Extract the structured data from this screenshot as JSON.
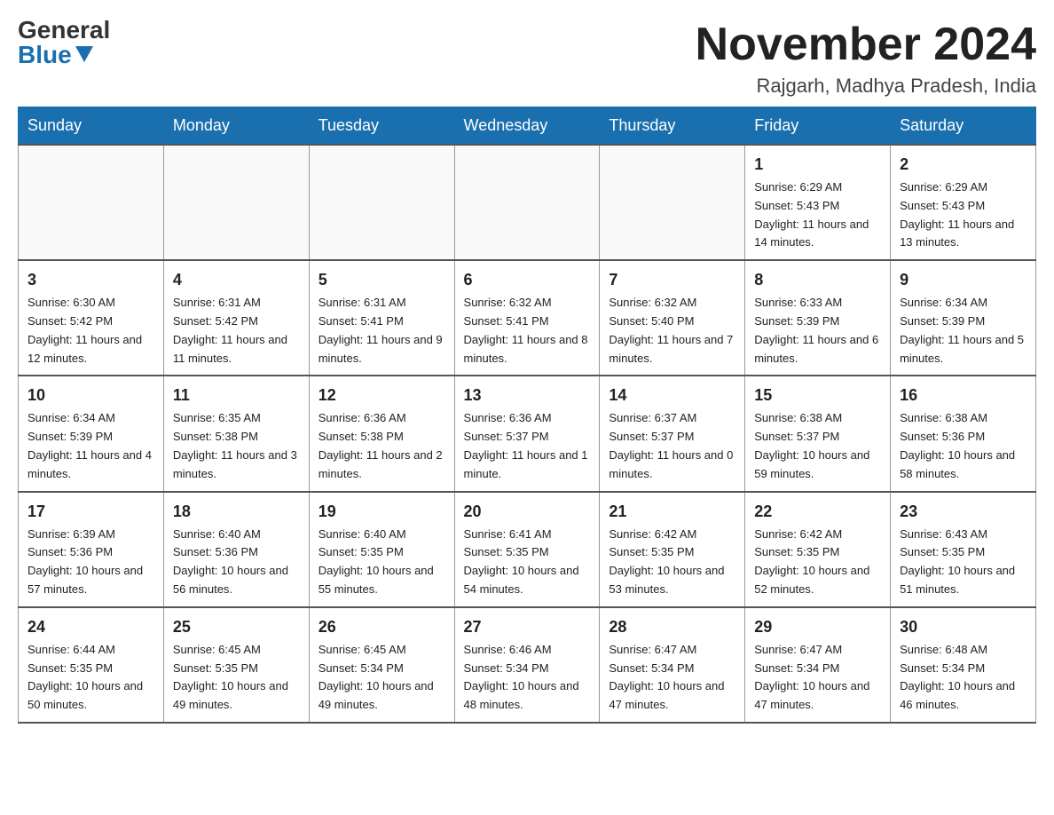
{
  "logo": {
    "general": "General",
    "blue": "Blue"
  },
  "header": {
    "title": "November 2024",
    "subtitle": "Rajgarh, Madhya Pradesh, India"
  },
  "days_of_week": [
    "Sunday",
    "Monday",
    "Tuesday",
    "Wednesday",
    "Thursday",
    "Friday",
    "Saturday"
  ],
  "weeks": [
    [
      {
        "day": "",
        "sunrise": "",
        "sunset": "",
        "daylight": "",
        "empty": true
      },
      {
        "day": "",
        "sunrise": "",
        "sunset": "",
        "daylight": "",
        "empty": true
      },
      {
        "day": "",
        "sunrise": "",
        "sunset": "",
        "daylight": "",
        "empty": true
      },
      {
        "day": "",
        "sunrise": "",
        "sunset": "",
        "daylight": "",
        "empty": true
      },
      {
        "day": "",
        "sunrise": "",
        "sunset": "",
        "daylight": "",
        "empty": true
      },
      {
        "day": "1",
        "sunrise": "Sunrise: 6:29 AM",
        "sunset": "Sunset: 5:43 PM",
        "daylight": "Daylight: 11 hours and 14 minutes.",
        "empty": false
      },
      {
        "day": "2",
        "sunrise": "Sunrise: 6:29 AM",
        "sunset": "Sunset: 5:43 PM",
        "daylight": "Daylight: 11 hours and 13 minutes.",
        "empty": false
      }
    ],
    [
      {
        "day": "3",
        "sunrise": "Sunrise: 6:30 AM",
        "sunset": "Sunset: 5:42 PM",
        "daylight": "Daylight: 11 hours and 12 minutes.",
        "empty": false
      },
      {
        "day": "4",
        "sunrise": "Sunrise: 6:31 AM",
        "sunset": "Sunset: 5:42 PM",
        "daylight": "Daylight: 11 hours and 11 minutes.",
        "empty": false
      },
      {
        "day": "5",
        "sunrise": "Sunrise: 6:31 AM",
        "sunset": "Sunset: 5:41 PM",
        "daylight": "Daylight: 11 hours and 9 minutes.",
        "empty": false
      },
      {
        "day": "6",
        "sunrise": "Sunrise: 6:32 AM",
        "sunset": "Sunset: 5:41 PM",
        "daylight": "Daylight: 11 hours and 8 minutes.",
        "empty": false
      },
      {
        "day": "7",
        "sunrise": "Sunrise: 6:32 AM",
        "sunset": "Sunset: 5:40 PM",
        "daylight": "Daylight: 11 hours and 7 minutes.",
        "empty": false
      },
      {
        "day": "8",
        "sunrise": "Sunrise: 6:33 AM",
        "sunset": "Sunset: 5:39 PM",
        "daylight": "Daylight: 11 hours and 6 minutes.",
        "empty": false
      },
      {
        "day": "9",
        "sunrise": "Sunrise: 6:34 AM",
        "sunset": "Sunset: 5:39 PM",
        "daylight": "Daylight: 11 hours and 5 minutes.",
        "empty": false
      }
    ],
    [
      {
        "day": "10",
        "sunrise": "Sunrise: 6:34 AM",
        "sunset": "Sunset: 5:39 PM",
        "daylight": "Daylight: 11 hours and 4 minutes.",
        "empty": false
      },
      {
        "day": "11",
        "sunrise": "Sunrise: 6:35 AM",
        "sunset": "Sunset: 5:38 PM",
        "daylight": "Daylight: 11 hours and 3 minutes.",
        "empty": false
      },
      {
        "day": "12",
        "sunrise": "Sunrise: 6:36 AM",
        "sunset": "Sunset: 5:38 PM",
        "daylight": "Daylight: 11 hours and 2 minutes.",
        "empty": false
      },
      {
        "day": "13",
        "sunrise": "Sunrise: 6:36 AM",
        "sunset": "Sunset: 5:37 PM",
        "daylight": "Daylight: 11 hours and 1 minute.",
        "empty": false
      },
      {
        "day": "14",
        "sunrise": "Sunrise: 6:37 AM",
        "sunset": "Sunset: 5:37 PM",
        "daylight": "Daylight: 11 hours and 0 minutes.",
        "empty": false
      },
      {
        "day": "15",
        "sunrise": "Sunrise: 6:38 AM",
        "sunset": "Sunset: 5:37 PM",
        "daylight": "Daylight: 10 hours and 59 minutes.",
        "empty": false
      },
      {
        "day": "16",
        "sunrise": "Sunrise: 6:38 AM",
        "sunset": "Sunset: 5:36 PM",
        "daylight": "Daylight: 10 hours and 58 minutes.",
        "empty": false
      }
    ],
    [
      {
        "day": "17",
        "sunrise": "Sunrise: 6:39 AM",
        "sunset": "Sunset: 5:36 PM",
        "daylight": "Daylight: 10 hours and 57 minutes.",
        "empty": false
      },
      {
        "day": "18",
        "sunrise": "Sunrise: 6:40 AM",
        "sunset": "Sunset: 5:36 PM",
        "daylight": "Daylight: 10 hours and 56 minutes.",
        "empty": false
      },
      {
        "day": "19",
        "sunrise": "Sunrise: 6:40 AM",
        "sunset": "Sunset: 5:35 PM",
        "daylight": "Daylight: 10 hours and 55 minutes.",
        "empty": false
      },
      {
        "day": "20",
        "sunrise": "Sunrise: 6:41 AM",
        "sunset": "Sunset: 5:35 PM",
        "daylight": "Daylight: 10 hours and 54 minutes.",
        "empty": false
      },
      {
        "day": "21",
        "sunrise": "Sunrise: 6:42 AM",
        "sunset": "Sunset: 5:35 PM",
        "daylight": "Daylight: 10 hours and 53 minutes.",
        "empty": false
      },
      {
        "day": "22",
        "sunrise": "Sunrise: 6:42 AM",
        "sunset": "Sunset: 5:35 PM",
        "daylight": "Daylight: 10 hours and 52 minutes.",
        "empty": false
      },
      {
        "day": "23",
        "sunrise": "Sunrise: 6:43 AM",
        "sunset": "Sunset: 5:35 PM",
        "daylight": "Daylight: 10 hours and 51 minutes.",
        "empty": false
      }
    ],
    [
      {
        "day": "24",
        "sunrise": "Sunrise: 6:44 AM",
        "sunset": "Sunset: 5:35 PM",
        "daylight": "Daylight: 10 hours and 50 minutes.",
        "empty": false
      },
      {
        "day": "25",
        "sunrise": "Sunrise: 6:45 AM",
        "sunset": "Sunset: 5:35 PM",
        "daylight": "Daylight: 10 hours and 49 minutes.",
        "empty": false
      },
      {
        "day": "26",
        "sunrise": "Sunrise: 6:45 AM",
        "sunset": "Sunset: 5:34 PM",
        "daylight": "Daylight: 10 hours and 49 minutes.",
        "empty": false
      },
      {
        "day": "27",
        "sunrise": "Sunrise: 6:46 AM",
        "sunset": "Sunset: 5:34 PM",
        "daylight": "Daylight: 10 hours and 48 minutes.",
        "empty": false
      },
      {
        "day": "28",
        "sunrise": "Sunrise: 6:47 AM",
        "sunset": "Sunset: 5:34 PM",
        "daylight": "Daylight: 10 hours and 47 minutes.",
        "empty": false
      },
      {
        "day": "29",
        "sunrise": "Sunrise: 6:47 AM",
        "sunset": "Sunset: 5:34 PM",
        "daylight": "Daylight: 10 hours and 47 minutes.",
        "empty": false
      },
      {
        "day": "30",
        "sunrise": "Sunrise: 6:48 AM",
        "sunset": "Sunset: 5:34 PM",
        "daylight": "Daylight: 10 hours and 46 minutes.",
        "empty": false
      }
    ]
  ]
}
